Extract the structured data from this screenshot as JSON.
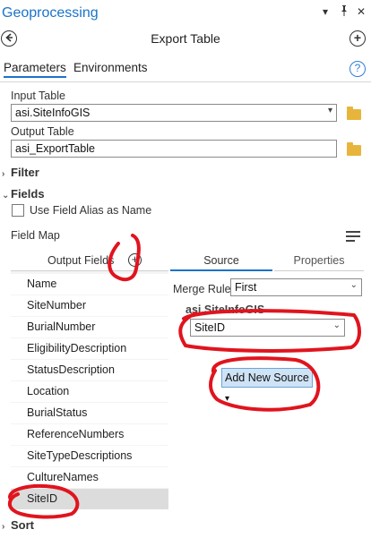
{
  "pane": {
    "title": "Geoprocessing",
    "window_controls": {
      "menu": "▾",
      "pin": "📌",
      "close": "✕"
    },
    "tool_name": "Export Table"
  },
  "tabs": [
    {
      "label": "Parameters",
      "active": true
    },
    {
      "label": "Environments",
      "active": false
    }
  ],
  "input_table": {
    "label": "Input Table",
    "value": "asi.SiteInfoGIS"
  },
  "output_table": {
    "label": "Output Table",
    "value": "asi_ExportTable"
  },
  "filter": {
    "label": "Filter"
  },
  "fields": {
    "label": "Fields",
    "use_alias_checkbox": {
      "label": "Use Field Alias as Name",
      "checked": false
    },
    "field_map_label": "Field Map"
  },
  "field_map": {
    "output_fields_header": "Output Fields",
    "items": [
      "Name",
      "SiteNumber",
      "BurialNumber",
      "EligibilityDescription",
      "StatusDescription",
      "Location",
      "BurialStatus",
      "ReferenceNumbers",
      "SiteTypeDescriptions",
      "CultureNames",
      "SiteID"
    ],
    "selected_item": "SiteID",
    "source_tab": "Source",
    "properties_tab": "Properties",
    "merge_rule_label": "Merge Rule",
    "merge_rule_value": "First",
    "source_table_label": "asi.SiteInfoGIS",
    "source_field_value": "SiteID",
    "add_new_source_label": "Add New Source"
  },
  "sort": {
    "label": "Sort"
  },
  "colors": {
    "accent": "#1a73c8",
    "annotation_ink": "#e0141e"
  },
  "icons": [
    "back-icon",
    "add-circle-icon",
    "help-icon",
    "folder-icon",
    "chevron-down-icon",
    "chevron-right-icon",
    "field-map-options-icon"
  ]
}
